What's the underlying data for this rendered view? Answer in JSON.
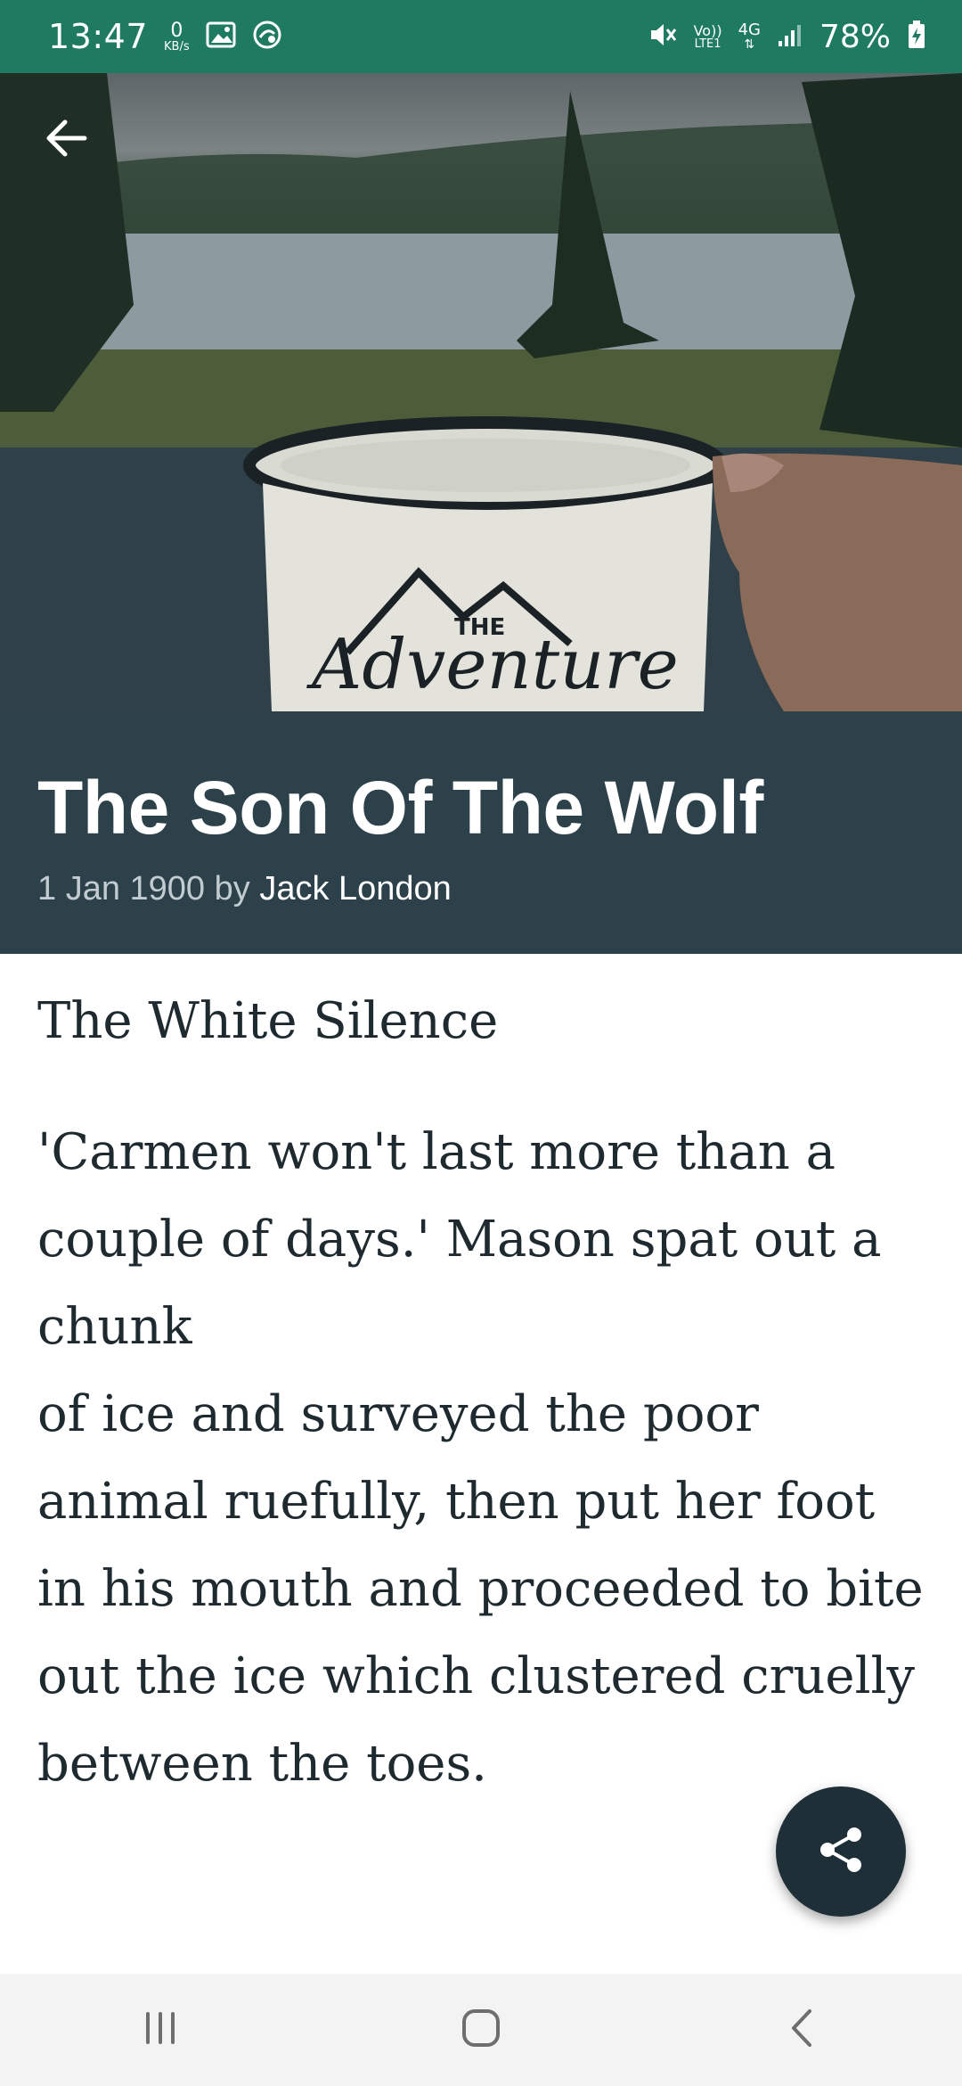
{
  "status_bar": {
    "time": "13:47",
    "net_speed_value": "0",
    "net_speed_unit": "KB/s",
    "volte_label_top": "Vo))",
    "volte_label_bottom": "LTE1",
    "network_label": "4G",
    "battery_text": "78%",
    "icons": [
      "image-notification-icon",
      "sync-notification-icon",
      "mute-icon",
      "signal-icon",
      "battery-charging-icon"
    ]
  },
  "header": {
    "back_icon": "arrow-left-icon"
  },
  "hero_image": {
    "description_icon": "hero-image"
  },
  "article": {
    "title": "The Son Of The Wolf",
    "date": "1 Jan 1900 by",
    "author": "Jack London",
    "chapter": "The White Silence",
    "paragraph": "'Carmen won't last more than a couple of days.' Mason spat out a chunk\nof ice and surveyed the poor animal ruefully, then put her foot in his mouth and proceeded to bite out the ice which clustered cruelly between the toes."
  },
  "fab": {
    "icon": "share-icon"
  },
  "nav_bar": {
    "icons": [
      "recents-icon",
      "home-icon",
      "back-nav-icon"
    ]
  },
  "colors": {
    "status_bar": "#1f7a62",
    "title_block": "#2c414a",
    "fab": "#1e2f37",
    "body_text": "#1e2a30",
    "nav_bar": "#f3f3f3"
  }
}
